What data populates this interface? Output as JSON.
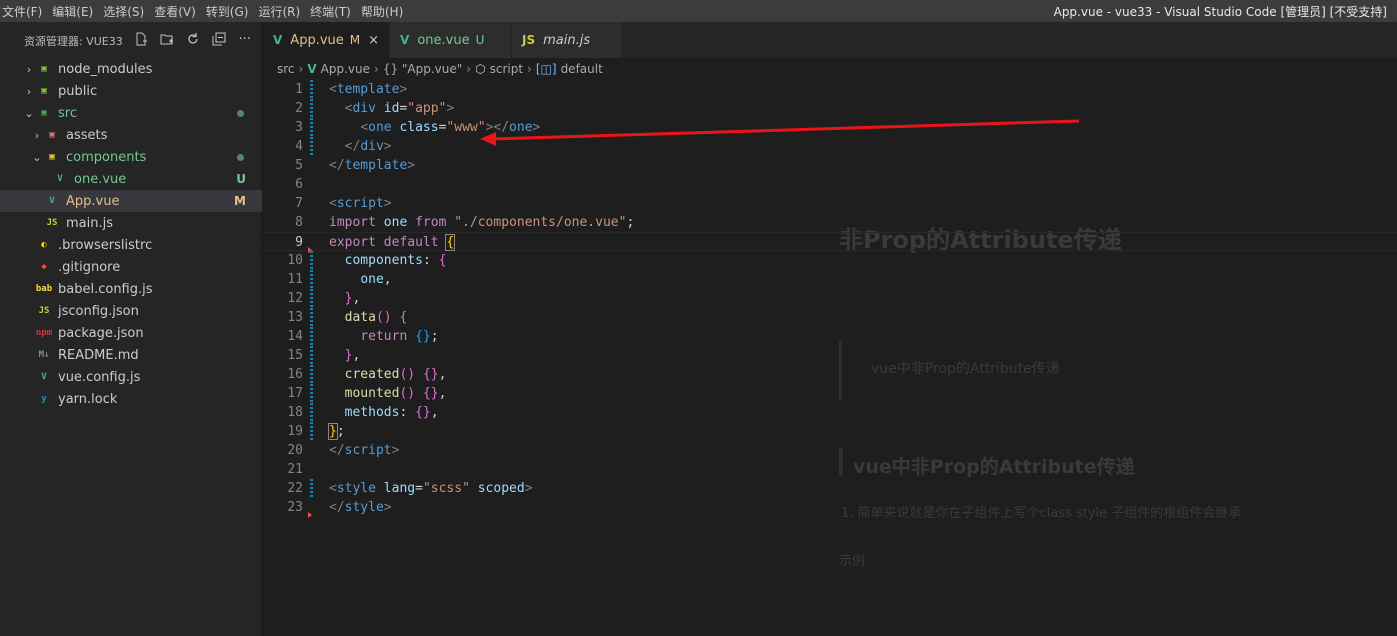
{
  "menubar": {
    "items": [
      "文件(F)",
      "编辑(E)",
      "选择(S)",
      "查看(V)",
      "转到(G)",
      "运行(R)",
      "终端(T)",
      "帮助(H)"
    ],
    "window_title": "App.vue - vue33 - Visual Studio Code [管理员] [不受支持]"
  },
  "explorer": {
    "title": "资源管理器: VUE33",
    "actions": [
      "new-file",
      "new-folder",
      "refresh",
      "collapse-all",
      "more"
    ],
    "items": [
      {
        "label": "node_modules",
        "icon": "folder-node",
        "indent": 0,
        "chevron": "›",
        "color": "#cccccc"
      },
      {
        "label": "public",
        "icon": "folder-public",
        "indent": 0,
        "chevron": "›",
        "color": "#cccccc"
      },
      {
        "label": "src",
        "icon": "folder-src",
        "indent": 0,
        "chevron": "⌄",
        "color": "#73c991",
        "dot": "#73c991"
      },
      {
        "label": "assets",
        "icon": "folder-assets",
        "indent": 1,
        "chevron": "›",
        "color": "#cccccc"
      },
      {
        "label": "components",
        "icon": "folder-components",
        "indent": 1,
        "chevron": "⌄",
        "color": "#73c991",
        "dot": "#73c991"
      },
      {
        "label": "one.vue",
        "icon": "vue",
        "indent": 2,
        "chevron": "",
        "color": "#73c991",
        "badge": "U"
      },
      {
        "label": "App.vue",
        "icon": "vue",
        "indent": 1,
        "chevron": "",
        "color": "#e2c08d",
        "badge": "M",
        "selected": true
      },
      {
        "label": "main.js",
        "icon": "js",
        "indent": 1,
        "chevron": "",
        "color": "#cccccc"
      },
      {
        "label": ".browserslistrc",
        "icon": "browserslist",
        "indent": 0,
        "chevron": "",
        "color": "#cccccc"
      },
      {
        "label": ".gitignore",
        "icon": "git",
        "indent": 0,
        "chevron": "",
        "color": "#cccccc"
      },
      {
        "label": "babel.config.js",
        "icon": "babel",
        "indent": 0,
        "chevron": "",
        "color": "#cccccc"
      },
      {
        "label": "jsconfig.json",
        "icon": "js",
        "indent": 0,
        "chevron": "",
        "color": "#cccccc"
      },
      {
        "label": "package.json",
        "icon": "npm",
        "indent": 0,
        "chevron": "",
        "color": "#cccccc"
      },
      {
        "label": "README.md",
        "icon": "markdown",
        "indent": 0,
        "chevron": "",
        "color": "#cccccc"
      },
      {
        "label": "vue.config.js",
        "icon": "vue-config",
        "indent": 0,
        "chevron": "",
        "color": "#cccccc"
      },
      {
        "label": "yarn.lock",
        "icon": "yarn",
        "indent": 0,
        "chevron": "",
        "color": "#cccccc"
      }
    ]
  },
  "tabs": [
    {
      "label": "App.vue",
      "status": "M",
      "icon": "V",
      "icon_color": "#41b883",
      "label_color": "#e2c08d",
      "active": true,
      "close": "×"
    },
    {
      "label": "one.vue",
      "status": "U",
      "icon": "V",
      "icon_color": "#41b883",
      "label_color": "#73c991",
      "active": false
    },
    {
      "label": "main.js",
      "status": "",
      "icon": "JS",
      "icon_color": "#cbcb41",
      "label_color": "#cccccc",
      "active": false,
      "italic": true
    }
  ],
  "breadcrumb": [
    "src",
    "App.vue",
    "{} \"App.vue\"",
    "script",
    "default"
  ],
  "code": {
    "current_line": 9,
    "lines": [
      {
        "n": "1",
        "g": "mod",
        "t": [
          [
            "t-tag",
            "<"
          ],
          [
            "t-tn",
            "template"
          ],
          [
            "t-tag",
            ">"
          ]
        ]
      },
      {
        "n": "2",
        "g": "mod",
        "t": [
          [
            "",
            "  "
          ],
          [
            "t-tag",
            "<"
          ],
          [
            "t-tn",
            "div"
          ],
          [
            "",
            " "
          ],
          [
            "t-at",
            "id"
          ],
          [
            "",
            "="
          ],
          [
            "t-str",
            "\"app\""
          ],
          [
            "t-tag",
            ">"
          ]
        ]
      },
      {
        "n": "3",
        "g": "mod",
        "t": [
          [
            "",
            "    "
          ],
          [
            "t-tag",
            "<"
          ],
          [
            "t-tn",
            "one"
          ],
          [
            "",
            " "
          ],
          [
            "t-at",
            "class"
          ],
          [
            "",
            "="
          ],
          [
            "t-str",
            "\"www\""
          ],
          [
            "t-tag",
            "></"
          ],
          [
            "t-tn",
            "one"
          ],
          [
            "t-tag",
            ">"
          ]
        ]
      },
      {
        "n": "4",
        "g": "mod",
        "t": [
          [
            "",
            "  "
          ],
          [
            "t-tag",
            "</"
          ],
          [
            "t-tn",
            "div"
          ],
          [
            "t-tag",
            ">"
          ]
        ]
      },
      {
        "n": "5",
        "g": "",
        "t": [
          [
            "t-tag",
            "</"
          ],
          [
            "t-tn",
            "template"
          ],
          [
            "t-tag",
            ">"
          ]
        ]
      },
      {
        "n": "6",
        "g": "",
        "t": []
      },
      {
        "n": "7",
        "g": "",
        "t": [
          [
            "t-tag",
            "<"
          ],
          [
            "t-tn",
            "script"
          ],
          [
            "t-tag",
            ">"
          ]
        ]
      },
      {
        "n": "8",
        "g": "",
        "t": [
          [
            "t-kw",
            "import"
          ],
          [
            "",
            " "
          ],
          [
            "t-at",
            "one"
          ],
          [
            "",
            " "
          ],
          [
            "t-kw",
            "from"
          ],
          [
            "",
            " "
          ],
          [
            "t-str",
            "\"./components/one.vue\""
          ],
          [
            "",
            ";"
          ]
        ]
      },
      {
        "n": "9",
        "g": "del",
        "t": [
          [
            "t-kw",
            "export"
          ],
          [
            "",
            " "
          ],
          [
            "t-kw",
            "default"
          ],
          [
            "",
            " "
          ],
          [
            "t-br1 t-br-box",
            "{"
          ]
        ]
      },
      {
        "n": "10",
        "g": "mod",
        "t": [
          [
            "",
            "  "
          ],
          [
            "t-at",
            "components"
          ],
          [
            "",
            ": "
          ],
          [
            "t-br2",
            "{"
          ]
        ]
      },
      {
        "n": "11",
        "g": "mod",
        "t": [
          [
            "",
            "    "
          ],
          [
            "t-at",
            "one"
          ],
          [
            "",
            ","
          ]
        ]
      },
      {
        "n": "12",
        "g": "mod",
        "t": [
          [
            "",
            "  "
          ],
          [
            "t-br2",
            "}"
          ],
          [
            "",
            ","
          ]
        ]
      },
      {
        "n": "13",
        "g": "mod",
        "t": [
          [
            "",
            "  "
          ],
          [
            "t-fn",
            "data"
          ],
          [
            "t-br2",
            "()"
          ],
          [
            "",
            " "
          ],
          [
            "t-br2",
            "{"
          ]
        ]
      },
      {
        "n": "14",
        "g": "mod",
        "t": [
          [
            "",
            "    "
          ],
          [
            "t-kw",
            "return"
          ],
          [
            "",
            " "
          ],
          [
            "t-br3",
            "{}"
          ],
          [
            "",
            ";"
          ]
        ]
      },
      {
        "n": "15",
        "g": "mod",
        "t": [
          [
            "",
            "  "
          ],
          [
            "t-br2",
            "}"
          ],
          [
            "",
            ","
          ]
        ]
      },
      {
        "n": "16",
        "g": "mod",
        "t": [
          [
            "",
            "  "
          ],
          [
            "t-fn",
            "created"
          ],
          [
            "t-br2",
            "()"
          ],
          [
            "",
            " "
          ],
          [
            "t-br2",
            "{}"
          ],
          [
            "",
            ","
          ]
        ]
      },
      {
        "n": "17",
        "g": "mod",
        "t": [
          [
            "",
            "  "
          ],
          [
            "t-fn",
            "mounted"
          ],
          [
            "t-br2",
            "()"
          ],
          [
            "",
            " "
          ],
          [
            "t-br2",
            "{}"
          ],
          [
            "",
            ","
          ]
        ]
      },
      {
        "n": "18",
        "g": "mod",
        "t": [
          [
            "",
            "  "
          ],
          [
            "t-at",
            "methods"
          ],
          [
            "",
            ": "
          ],
          [
            "t-br2",
            "{}"
          ],
          [
            "",
            ","
          ]
        ]
      },
      {
        "n": "19",
        "g": "mod",
        "t": [
          [
            "t-br1 t-br-box",
            "}"
          ],
          [
            "",
            ";"
          ]
        ]
      },
      {
        "n": "20",
        "g": "",
        "t": [
          [
            "t-tag",
            "</"
          ],
          [
            "t-tn",
            "script"
          ],
          [
            "t-tag",
            ">"
          ]
        ]
      },
      {
        "n": "21",
        "g": "",
        "t": []
      },
      {
        "n": "22",
        "g": "mod",
        "t": [
          [
            "t-tag",
            "<"
          ],
          [
            "t-tn",
            "style"
          ],
          [
            "",
            " "
          ],
          [
            "t-at",
            "lang"
          ],
          [
            "",
            "="
          ],
          [
            "t-str",
            "\"scss\""
          ],
          [
            "",
            " "
          ],
          [
            "t-at",
            "scoped"
          ],
          [
            "t-tag",
            ">"
          ]
        ]
      },
      {
        "n": "23",
        "g": "del",
        "t": [
          [
            "t-tag",
            "</"
          ],
          [
            "t-tn",
            "style"
          ],
          [
            "t-tag",
            ">"
          ]
        ]
      }
    ]
  },
  "background_page": {
    "heading": "非Prop的Attribute传递",
    "quote": "vue中非Prop的Attribute传递",
    "subheading": "vue中非Prop的Attribute传递",
    "paragraph": "1. 简单来说就是你在子组件上写个class style 子组件的根组件会继承",
    "example": "示例"
  },
  "colors": {
    "annotation_arrow": "#e8161b",
    "accent_modified": "#e2c08d",
    "accent_untracked": "#73c991"
  }
}
